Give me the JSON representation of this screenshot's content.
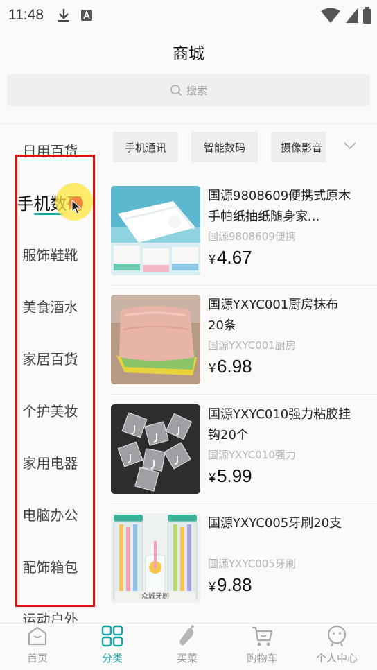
{
  "status_bar": {
    "time": "11:48"
  },
  "header": {
    "title": "商城"
  },
  "search": {
    "placeholder": "搜索"
  },
  "sidebar": {
    "items": [
      {
        "label": "日用百货"
      },
      {
        "label": "手机数码",
        "active": true
      },
      {
        "label": "服饰鞋靴"
      },
      {
        "label": "美食酒水"
      },
      {
        "label": "家居百货"
      },
      {
        "label": "个护美妆"
      },
      {
        "label": "家用电器"
      },
      {
        "label": "电脑办公"
      },
      {
        "label": "配饰箱包"
      },
      {
        "label": "运动户外"
      }
    ]
  },
  "subcategories": [
    {
      "label": "手机通讯"
    },
    {
      "label": "智能数码"
    },
    {
      "label": "摄像影音"
    }
  ],
  "products": [
    {
      "name": "国源9808609便携式原木手帕纸抽纸随身家...",
      "subtitle": "国源9808609便携",
      "currency": "¥",
      "price": "4.67",
      "image": "tissue-box-image"
    },
    {
      "name": "国源YXYC001厨房抹布20条",
      "subtitle": "国源YXYC001厨房",
      "currency": "¥",
      "price": "6.98",
      "image": "kitchen-cloth-image"
    },
    {
      "name": "国源YXYC010强力粘胶挂钩20个",
      "subtitle": "国源YXYC010强力",
      "currency": "¥",
      "price": "5.99",
      "image": "adhesive-hooks-image"
    },
    {
      "name": "国源YXYC005牙刷20支",
      "subtitle": "国源YXYC005牙刷",
      "currency": "¥",
      "price": "9.88",
      "image": "toothbrush-image",
      "image_caption": "众城牙刷"
    }
  ],
  "bottom_nav": {
    "items": [
      {
        "label": "首页",
        "icon": "home-icon"
      },
      {
        "label": "分类",
        "icon": "category-grid-icon",
        "active": true
      },
      {
        "label": "买菜",
        "icon": "vegetable-icon"
      },
      {
        "label": "购物车",
        "icon": "cart-icon"
      },
      {
        "label": "个人中心",
        "icon": "profile-icon"
      }
    ]
  },
  "colors": {
    "accent": "#1ba6a6",
    "highlight_frame": "#e01010"
  }
}
